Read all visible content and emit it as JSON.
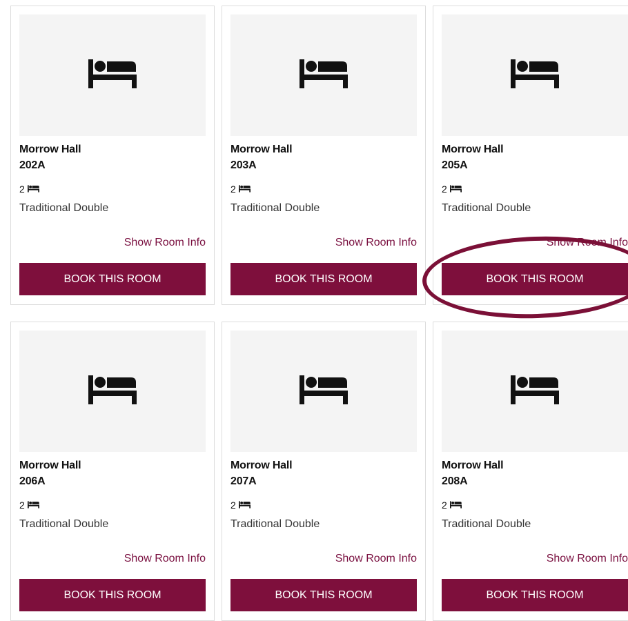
{
  "rooms": [
    {
      "hall": "Morrow Hall",
      "room": "202A",
      "beds": "2",
      "type": "Traditional Double",
      "info": "Show Room Info",
      "book": "BOOK THIS ROOM"
    },
    {
      "hall": "Morrow Hall",
      "room": "203A",
      "beds": "2",
      "type": "Traditional Double",
      "info": "Show Room Info",
      "book": "BOOK THIS ROOM"
    },
    {
      "hall": "Morrow Hall",
      "room": "205A",
      "beds": "2",
      "type": "Traditional Double",
      "info": "Show Room Info",
      "book": "BOOK THIS ROOM"
    },
    {
      "hall": "Morrow Hall",
      "room": "206A",
      "beds": "2",
      "type": "Traditional Double",
      "info": "Show Room Info",
      "book": "BOOK THIS ROOM"
    },
    {
      "hall": "Morrow Hall",
      "room": "207A",
      "beds": "2",
      "type": "Traditional Double",
      "info": "Show Room Info",
      "book": "BOOK THIS ROOM"
    },
    {
      "hall": "Morrow Hall",
      "room": "208A",
      "beds": "2",
      "type": "Traditional Double",
      "info": "Show Room Info",
      "book": "BOOK THIS ROOM"
    }
  ],
  "icons": {
    "room_image": "bed-icon",
    "beds": "bed-icon"
  },
  "colors": {
    "button_bg": "#7e0f3c",
    "button_text": "#ffffff",
    "link": "#7a1040",
    "image_bg": "#f4f4f4",
    "highlight": "#7b1037"
  }
}
